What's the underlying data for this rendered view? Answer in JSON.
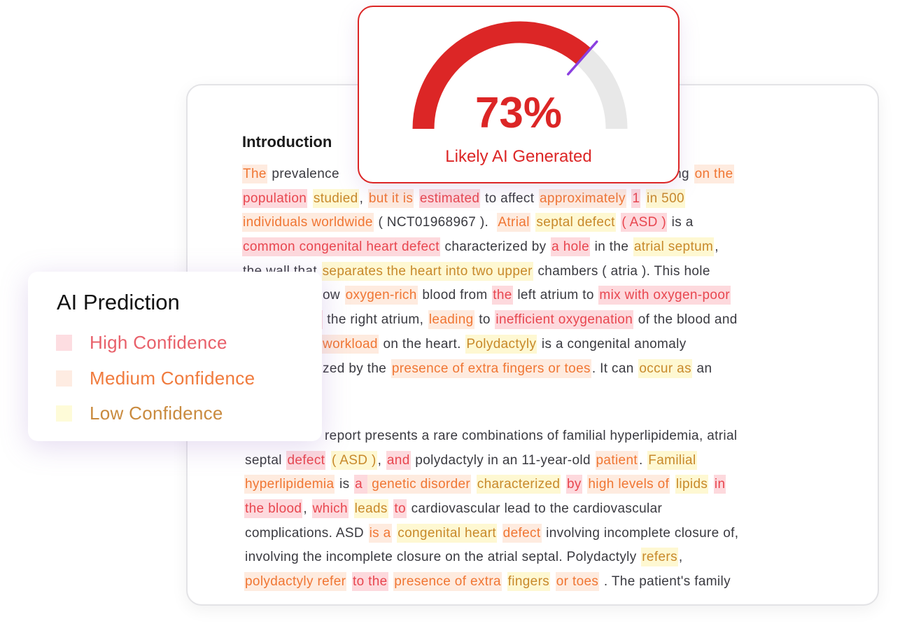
{
  "gauge": {
    "percent": 73,
    "value_label": "73%",
    "label": "Likely AI Generated",
    "fill_color": "#dc2626",
    "track_color": "#e8e8e8",
    "marker_color": "#8b3fe0"
  },
  "legend": {
    "title": "AI Prediction",
    "items": [
      {
        "label": "High Confidence",
        "swatch": "#fddde1",
        "text_color": "#e8606a"
      },
      {
        "label": "Medium Confidence",
        "swatch": "#feece2",
        "text_color": "#f07a3c"
      },
      {
        "label": "Low Confidence",
        "swatch": "#fefbd8",
        "text_color": "#c98a3e"
      }
    ]
  },
  "document": {
    "title": "Introduction",
    "paragraph1": [
      [
        [
          "The",
          "m"
        ],
        [
          " prevalence ",
          null
        ],
        [
          "__spacer__",
          null
        ],
        [
          "ing ",
          null
        ],
        [
          "on the",
          "m"
        ]
      ],
      [
        [
          "population",
          "h"
        ],
        [
          " ",
          null
        ],
        [
          "studied",
          "l"
        ],
        [
          ", ",
          null
        ],
        [
          "but it is",
          "m"
        ],
        [
          " ",
          null
        ],
        [
          "estimated",
          "h"
        ],
        [
          " to affect ",
          null
        ],
        [
          "approximately",
          "m"
        ],
        [
          " ",
          null
        ],
        [
          "1",
          "h"
        ],
        [
          " ",
          null
        ],
        [
          "in 500",
          "l"
        ]
      ],
      [
        [
          "individuals worldwide",
          "m"
        ],
        [
          " ( NCT01968967 ).  ",
          null
        ],
        [
          "Atrial",
          "m"
        ],
        [
          " ",
          null
        ],
        [
          "septal defect",
          "l"
        ],
        [
          " ",
          null
        ],
        [
          "( ASD )",
          "h"
        ],
        [
          " is a",
          null
        ]
      ],
      [
        [
          "common congenital heart defect",
          "h"
        ],
        [
          " characterized by ",
          null
        ],
        [
          "a hole",
          "h"
        ],
        [
          " in the ",
          null
        ],
        [
          "atrial septum",
          "l"
        ],
        [
          ",",
          null
        ]
      ],
      [
        [
          "the wall that ",
          null
        ],
        [
          "separates the heart into two upper",
          "l"
        ],
        [
          " chambers ( atria ). This hole",
          null
        ]
      ],
      [
        [
          "ow ",
          null
        ],
        [
          "oxygen-rich",
          "m"
        ],
        [
          " blood from ",
          null
        ],
        [
          "the",
          "h"
        ],
        [
          " left atrium to ",
          null
        ],
        [
          "mix with oxygen-poor",
          "h"
        ]
      ],
      [
        [
          " ",
          "h"
        ],
        [
          " the right atrium, ",
          null
        ],
        [
          "leading",
          "m"
        ],
        [
          " to ",
          null
        ],
        [
          "inefficient oxygenation",
          "h"
        ],
        [
          " of the blood and",
          null
        ]
      ],
      [
        [
          "workload",
          "m"
        ],
        [
          " on the heart. ",
          null
        ],
        [
          "Polydactyly",
          "l"
        ],
        [
          " is a congenital anomaly",
          null
        ]
      ],
      [
        [
          "zed by the ",
          null
        ],
        [
          "presence of extra fingers or toes",
          "m"
        ],
        [
          ". It can ",
          null
        ],
        [
          "occur as",
          "l"
        ],
        [
          " an",
          null
        ]
      ]
    ],
    "paragraph2": [
      [
        [
          "report presents a rare combinations of familial hyperlipidemia, atrial",
          null
        ]
      ],
      [
        [
          "septal ",
          null
        ],
        [
          "defect",
          "h"
        ],
        [
          " ",
          null
        ],
        [
          "( ASD )",
          "l"
        ],
        [
          ", ",
          null
        ],
        [
          "and",
          "h"
        ],
        [
          " polydactyly in an 11-year-old ",
          null
        ],
        [
          "patient",
          "m"
        ],
        [
          ". ",
          null
        ],
        [
          "Familial",
          "l"
        ]
      ],
      [
        [
          "hyperlipidemia",
          "m"
        ],
        [
          " is ",
          null
        ],
        [
          "a ",
          "h"
        ],
        [
          " genetic disorder",
          "m"
        ],
        [
          " ",
          null
        ],
        [
          "characterized",
          "l"
        ],
        [
          " ",
          null
        ],
        [
          "by",
          "h"
        ],
        [
          " ",
          null
        ],
        [
          "high levels of",
          "m"
        ],
        [
          " ",
          null
        ],
        [
          "lipids",
          "l"
        ],
        [
          " ",
          null
        ],
        [
          "in",
          "h"
        ]
      ],
      [
        [
          "the blood",
          "h"
        ],
        [
          ", ",
          null
        ],
        [
          "which",
          "h"
        ],
        [
          " ",
          null
        ],
        [
          "leads",
          "l"
        ],
        [
          " ",
          null
        ],
        [
          "to",
          "h"
        ],
        [
          " cardiovascular lead to the cardiovascular",
          null
        ]
      ],
      [
        [
          "complications. ASD ",
          null
        ],
        [
          "is a",
          "m"
        ],
        [
          " ",
          null
        ],
        [
          "congenital heart",
          "l"
        ],
        [
          " ",
          null
        ],
        [
          "defect",
          "m"
        ],
        [
          " involving incomplete closure of,",
          null
        ]
      ],
      [
        [
          "involving the incomplete closure on the atrial septal. Polydactyly ",
          null
        ],
        [
          "refers",
          "l"
        ],
        [
          ",",
          null
        ]
      ],
      [
        [
          "polydactyly refer",
          "m"
        ],
        [
          " ",
          null
        ],
        [
          "to the",
          "h"
        ],
        [
          " ",
          null
        ],
        [
          "presence of extra",
          "m"
        ],
        [
          " ",
          null
        ],
        [
          "fingers",
          "l"
        ],
        [
          " ",
          null
        ],
        [
          "or toes",
          "m"
        ],
        [
          " . The patient's family",
          null
        ]
      ]
    ]
  }
}
